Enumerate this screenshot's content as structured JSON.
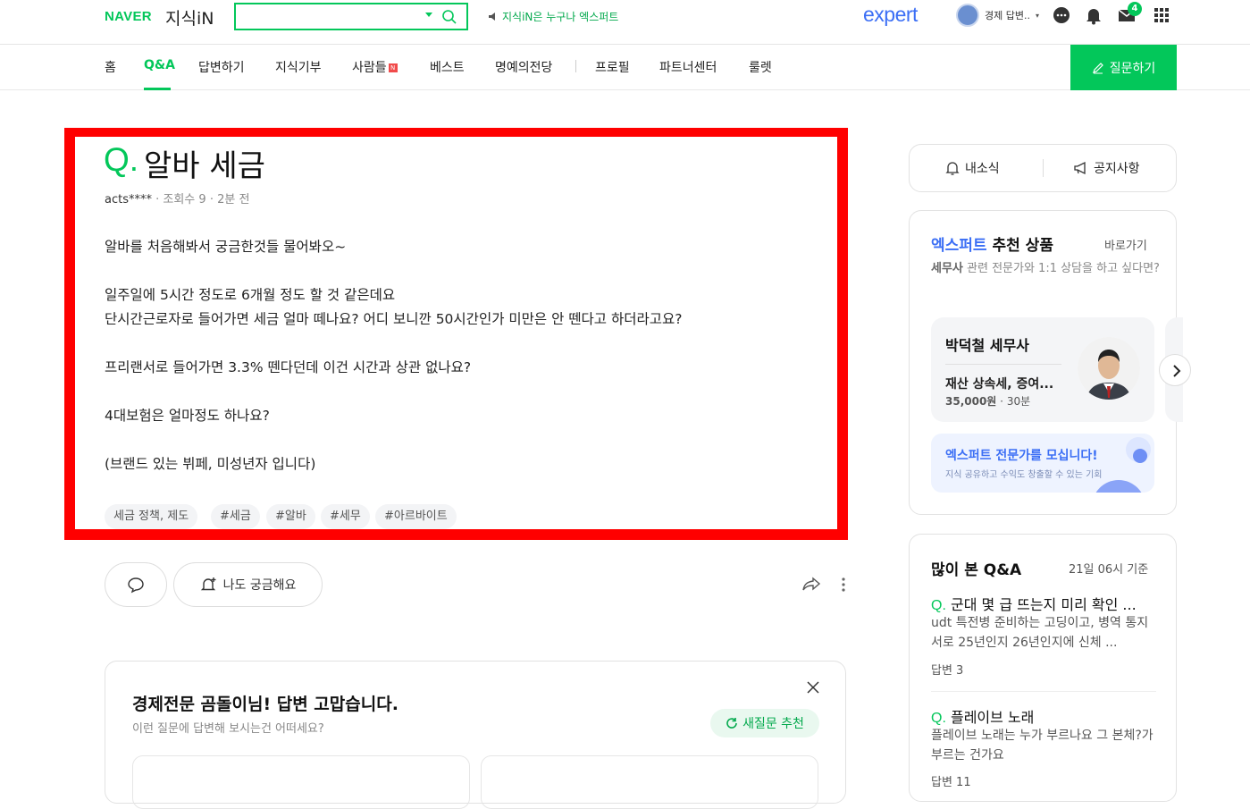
{
  "header": {
    "brand": "NAVER",
    "service": "지식iN",
    "search_placeholder": "",
    "promo_text": "지식iN은 누구나 엑스퍼트",
    "expert_logo": "expert",
    "user_name": "경제 답변..",
    "mail_badge": "4"
  },
  "nav": {
    "items": [
      "홈",
      "Q&A",
      "답변하기",
      "지식기부",
      "사람들",
      "베스트",
      "명예의전당",
      "프로필",
      "파트너센터",
      "룰렛"
    ],
    "new_badge": "N",
    "ask_button": "질문하기"
  },
  "question": {
    "q_mark": "Q.",
    "title": "알바 세금",
    "author": "acts****",
    "views": "조회수 9",
    "time": "2분 전",
    "body": [
      "알바를 처음해봐서 궁금한것들 물어봐오~",
      "일주일에 5시간 정도로 6개월 정도 할 것 같은데요",
      "단시간근로자로 들어가면 세금 얼마 떼나요? 어디 보니깐 50시간인가 미만은 안 뗀다고 하더라고요?",
      "프리랜서로 들어가면 3.3% 뗀다던데 이건 시간과 상관 없나요?",
      "4대보험은 얼마정도 하나요?",
      "(브랜드 있는 뷔페, 미성년자 입니다)"
    ],
    "tags": [
      "세금 정책, 제도",
      "#세금",
      "#알바",
      "#세무",
      "#아르바이트"
    ],
    "curious_button": "나도 궁금해요"
  },
  "answer_prompt": {
    "title": "경제전문 곰돌이님! 답변 고맙습니다.",
    "subtitle": "이런 질문에 답변해 보시는건 어떠세요?",
    "new_question_button": "새질문 추천"
  },
  "sidebar": {
    "news_button": "내소식",
    "notice_button": "공지사항",
    "expert": {
      "title_blue": "엑스퍼트",
      "title_rest": " 추천 상품",
      "goto": "바로가기",
      "desc_bold": "세무사",
      "desc_rest": " 관련 전문가와 1:1 상담을 하고 싶다면?",
      "card": {
        "name": "박덕철 세무사",
        "spec": "재산 상속세, 증여...",
        "price": "35,000원",
        "duration": "30분"
      },
      "recruit_title": "엑스퍼트 전문가를 모십니다!",
      "recruit_sub": "지식 공유하고 수익도 창출할 수 있는 기회"
    },
    "popular": {
      "title": "많이 본 Q&A",
      "time": "21일 06시 기준",
      "items": [
        {
          "q": "Q.",
          "title": "군대 몇 급 뜨는지 미리 확인 ...",
          "body": "udt 특전병 준비하는 고딩이고, 병역 통지서로 25년인지 26년인지에 신체 ...",
          "answers": "답변 3"
        },
        {
          "q": "Q.",
          "title": "플레이브 노래",
          "body": "플레이브 노래는 누가 부르나요 그 본체?가 부르는 건가요",
          "answers": "답변 11"
        }
      ]
    }
  },
  "colors": {
    "accent": "#03c75a",
    "expert_blue": "#3c6ff5",
    "highlight": "#ff0000"
  }
}
